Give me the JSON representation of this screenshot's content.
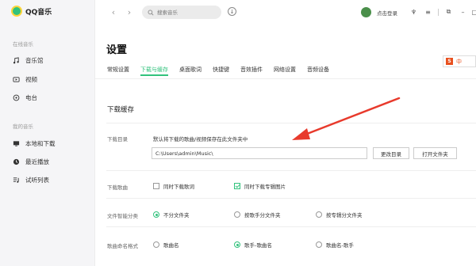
{
  "app": {
    "name": "QQ音乐"
  },
  "sidebar": {
    "online_section": "在线音乐",
    "my_section": "我的音乐",
    "items": [
      {
        "label": "音乐馆",
        "icon": "music-note-icon"
      },
      {
        "label": "视频",
        "icon": "video-icon"
      },
      {
        "label": "电台",
        "icon": "radio-icon"
      },
      {
        "label": "本地和下载",
        "icon": "computer-icon"
      },
      {
        "label": "最近播放",
        "icon": "clock-icon"
      },
      {
        "label": "试听列表",
        "icon": "playlist-icon"
      }
    ]
  },
  "topbar": {
    "back": "‹",
    "forward": "›",
    "search_placeholder": "搜索音乐",
    "login_text": "点击登录",
    "icons": [
      "download-icon",
      "shirt-icon",
      "menu-icon",
      "mini-mode-icon",
      "minimize-icon",
      "maximize-icon"
    ]
  },
  "page": {
    "title": "设置",
    "tabs": [
      "常规设置",
      "下载与缓存",
      "桌面歌词",
      "快捷键",
      "音效插件",
      "网络设置",
      "音频设备"
    ],
    "active_tab": "下载与缓存"
  },
  "ime": {
    "logo": "S",
    "lang": "中"
  },
  "download": {
    "section_title": "下载缓存",
    "dir_label": "下载目录",
    "dir_desc": "默认将下载的歌曲/视频保存在此文件夹中",
    "dir_path": "C:\\Users\\admin\\Music\\",
    "change_dir_button": "更改目录",
    "open_folder_button": "打开文件夹",
    "song_label": "下载歌曲",
    "song_options": [
      {
        "label": "同时下载歌词",
        "checked": false
      },
      {
        "label": "同时下载专辑图片",
        "checked": true
      }
    ],
    "classify_label": "文件智能分类",
    "classify_options": [
      {
        "label": "不分文件夹",
        "checked": true
      },
      {
        "label": "按歌手分文件夹",
        "checked": false
      },
      {
        "label": "按专辑分文件夹",
        "checked": false
      }
    ],
    "naming_label": "歌曲命名格式",
    "naming_options": [
      {
        "label": "歌曲名",
        "checked": false
      },
      {
        "label": "歌手-歌曲名",
        "checked": true
      },
      {
        "label": "歌曲名-歌手",
        "checked": false
      }
    ]
  },
  "colors": {
    "accent": "#31c27c",
    "arrow": "#e83a2c"
  }
}
